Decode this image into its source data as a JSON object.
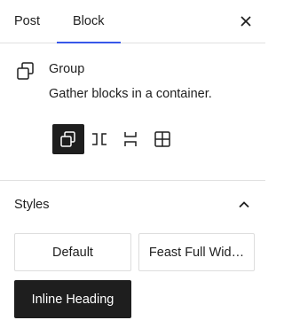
{
  "tabs": {
    "post": "Post",
    "block": "Block"
  },
  "accent_color": "#3858e9",
  "close_icon": "close-icon",
  "block": {
    "icon": "group-icon",
    "title": "Group",
    "description": "Gather blocks in a container.",
    "variations": [
      {
        "name": "group",
        "icon": "group-icon",
        "active": true
      },
      {
        "name": "row",
        "icon": "row-icon",
        "active": false
      },
      {
        "name": "stack",
        "icon": "stack-icon",
        "active": false
      },
      {
        "name": "grid",
        "icon": "grid-icon",
        "active": false
      }
    ]
  },
  "styles": {
    "title": "Styles",
    "expanded": true,
    "options": [
      {
        "label": "Default",
        "selected": false
      },
      {
        "label": "Feast Full Wid…",
        "selected": false
      },
      {
        "label": "Inline Heading",
        "selected": true
      }
    ]
  }
}
